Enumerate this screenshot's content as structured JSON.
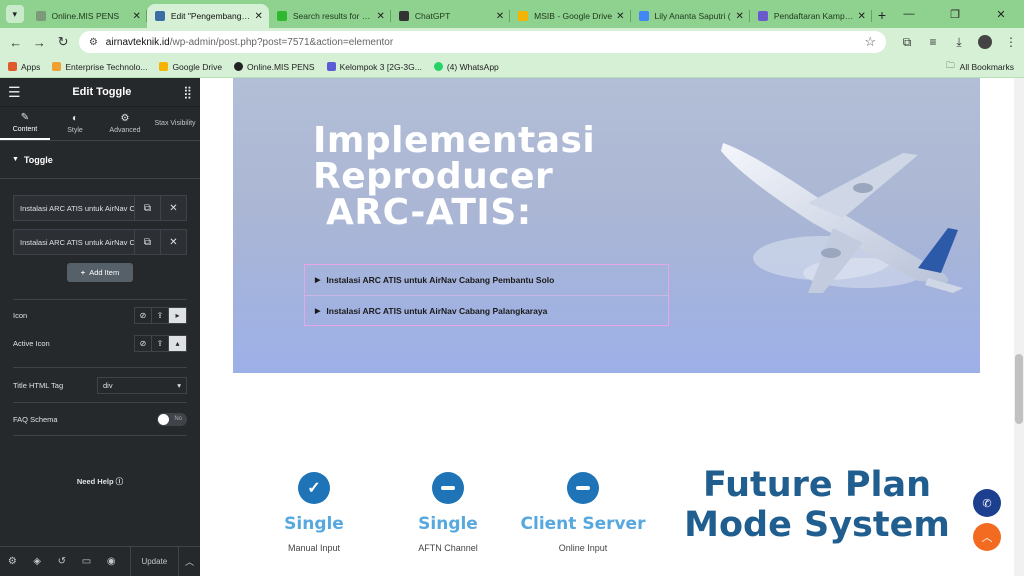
{
  "browser": {
    "tabs": [
      {
        "title": "Online.MIS PENS",
        "favicon_color": "#7a9a7a",
        "active": false
      },
      {
        "title": "Edit \"Pengembangan",
        "favicon_color": "#3a6ea5",
        "active": true
      },
      {
        "title": "Search results for Pla",
        "favicon_color": "#2eb82e",
        "active": false
      },
      {
        "title": "ChatGPT",
        "favicon_color": "#333333",
        "active": false
      },
      {
        "title": "MSIB - Google Drive",
        "favicon_color": "#f4b400",
        "active": false
      },
      {
        "title": "Lily Ananta Saputri (",
        "favicon_color": "#4285f4",
        "active": false
      },
      {
        "title": "Pendaftaran Kampus",
        "favicon_color": "#6a5acd",
        "active": false
      }
    ],
    "url_host": "airnavteknik.id",
    "url_path": "/wp-admin/post.php?post=7571&action=elementor",
    "bookmarks": [
      {
        "label": "Apps",
        "color": "#e05b2b"
      },
      {
        "label": "Enterprise Technolo...",
        "color": "#f0a030"
      },
      {
        "label": "Google Drive",
        "color": "#f4b400"
      },
      {
        "label": "Online.MIS PENS",
        "color": "#222222"
      },
      {
        "label": "Kelompok 3 [2G-3G...",
        "color": "#5b5bd6"
      },
      {
        "label": "(4) WhatsApp",
        "color": "#25d366"
      }
    ],
    "all_bookmarks_label": "All Bookmarks"
  },
  "panel": {
    "title": "Edit Toggle",
    "tabs": [
      {
        "label": "Content",
        "icon": "pencil-icon"
      },
      {
        "label": "Style",
        "icon": "half-circle-icon"
      },
      {
        "label": "Advanced",
        "icon": "gear-icon"
      },
      {
        "label": "Stax Visibility",
        "icon": ""
      }
    ],
    "section_title": "Toggle",
    "items": [
      "Instalasi ARC ATIS untuk AirNav Cabang Pembantu Solo",
      "Instalasi ARC ATIS untuk AirNav Cabang Palangkaraya"
    ],
    "add_item_label": "Add Item",
    "icon_label": "Icon",
    "active_icon_label": "Active Icon",
    "title_html_tag_label": "Title HTML Tag",
    "title_html_tag_value": "div",
    "faq_schema_label": "FAQ Schema",
    "faq_schema_value": "No",
    "need_help_label": "Need Help",
    "update_label": "Update"
  },
  "hero": {
    "title_lines": [
      "Implementasi",
      "Reproducer",
      " ARC-ATIS:"
    ],
    "toggles": [
      "Instalasi ARC ATIS untuk AirNav Cabang Pembantu Solo",
      "Instalasi ARC ATIS untuk AirNav Cabang Palangkaraya"
    ]
  },
  "features": [
    {
      "title": "Single",
      "subtitle": "Manual Input",
      "icon": "check-circle-icon"
    },
    {
      "title": "Single",
      "subtitle": "AFTN Channel",
      "icon": "minus-circle-icon"
    },
    {
      "title": "Client Server",
      "subtitle": "Online Input",
      "icon": "minus-circle-icon"
    }
  ],
  "future_plan": {
    "line1": "Future Plan",
    "line2": "Mode System"
  },
  "colors": {
    "browser_chrome": "#8fd18f",
    "panel_bg": "#26292c",
    "feature_blue": "#1f73b7",
    "feature_title": "#56a8de",
    "future_plan": "#1f5e8f",
    "toggle_border": "#e8a6e6",
    "fab_call": "#1d3f8f",
    "fab_top": "#f26b21"
  }
}
